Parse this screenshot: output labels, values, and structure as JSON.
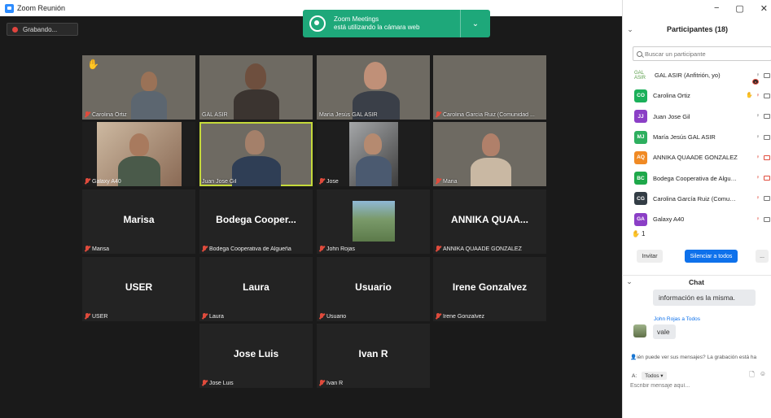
{
  "window": {
    "title": "Zoom Reunión",
    "controls": [
      "−",
      "▢",
      "✕"
    ]
  },
  "recording": {
    "label": "Grabando..."
  },
  "toast": {
    "line1": "Zoom Meetings",
    "line2": "está utilizando la cámara web",
    "chevron": "⌄"
  },
  "tiles": [
    {
      "display_name": "",
      "footer": "Carolina Ortiz",
      "hand": "✋"
    },
    {
      "display_name": "",
      "footer": "GAL ASIR"
    },
    {
      "display_name": "",
      "footer": "María Jesús GAL ASIR"
    },
    {
      "display_name": "",
      "footer": "Carolina García Ruiz (Comunidad ..."
    },
    {
      "display_name": "",
      "footer": "Galaxy A40"
    },
    {
      "display_name": "",
      "footer": "Juan Jose Gil"
    },
    {
      "display_name": "",
      "footer": "Jose"
    },
    {
      "display_name": "",
      "footer": "Maria"
    },
    {
      "display_name": "Marisa",
      "footer": "Marisa"
    },
    {
      "display_name": "Bodega Cooper...",
      "footer": "Bodega Cooperativa de Algueña"
    },
    {
      "display_name": "",
      "footer": "John Rojas"
    },
    {
      "display_name": "ANNIKA QUAA...",
      "footer": "ANNIKA QUAADE GONZALEZ"
    },
    {
      "display_name": "USER",
      "footer": "USER"
    },
    {
      "display_name": "Laura",
      "footer": "Laura"
    },
    {
      "display_name": "Usuario",
      "footer": "Usuario"
    },
    {
      "display_name": "Irene Gonzalvez",
      "footer": "Irene Gonzalvez"
    },
    {
      "display_name": "Jose Luis",
      "footer": "Jose Luis"
    },
    {
      "display_name": "Ivan R",
      "footer": "Ivan R"
    }
  ],
  "participants": {
    "header": "Participantes (18)",
    "search_placeholder": "Buscar un participante",
    "list": [
      {
        "initials": "GAL ASIR",
        "name": "GAL ASIR (Anfitrión, yo)",
        "color": ""
      },
      {
        "initials": "CO",
        "name": "Carolina Ortiz",
        "color": "#1bb05a"
      },
      {
        "initials": "JJ",
        "name": "Juan Jose Gil",
        "color": "#8b3fc6"
      },
      {
        "initials": "MJ",
        "name": "María Jesús GAL ASIR",
        "color": "#2eaf5f"
      },
      {
        "initials": "AQ",
        "name": "ANNIKA QUAADE GONZALEZ",
        "color": "#f08a24"
      },
      {
        "initials": "BC",
        "name": "Bodega Cooperativa de Algueña",
        "color": "#1ea84a"
      },
      {
        "initials": "CG",
        "name": "Carolina García Ruiz (Comunidad...",
        "color": "#333d45"
      },
      {
        "initials": "GA",
        "name": "Galaxy A40",
        "color": "#8b3fc6"
      }
    ],
    "raised_count": "1",
    "invite_label": "Invitar",
    "mute_all_label": "Silenciar a todos",
    "more_label": "..."
  },
  "chat": {
    "header": "Chat",
    "message1": "información es la misma.",
    "from_label": "John  Rojas a Todos",
    "message2": "vale",
    "notice": "ién puede ver sus mensajes? La grabación está ha",
    "to_label": "A:",
    "to_value": "Todos ▾",
    "compose_placeholder": "Escribir mensaje aquí..."
  },
  "colors": {
    "stage": "#1a1a1a",
    "tile": "#232323",
    "accent": "#0e71eb",
    "toast": "#1ea87a",
    "active_speaker": "#c5d93a",
    "muted": "#e04b3c"
  }
}
